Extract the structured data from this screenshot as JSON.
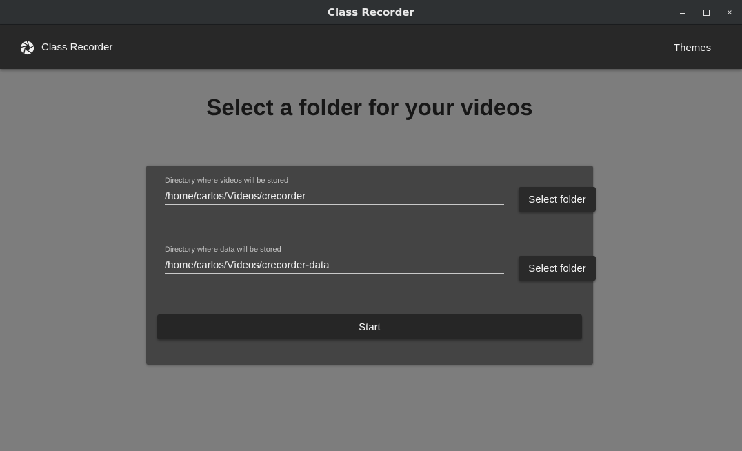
{
  "window": {
    "title": "Class Recorder",
    "minimize_icon": "minimize-icon",
    "maximize_icon": "maximize-icon",
    "close_icon": "close-icon",
    "close_glyph": "×"
  },
  "appbar": {
    "logo_icon": "camera-aperture-icon",
    "app_name": "Class Recorder",
    "themes_label": "Themes"
  },
  "main": {
    "heading": "Select a folder for your videos",
    "videos_field": {
      "label": "Directory where videos will be stored",
      "value": "/home/carlos/Vídeos/crecorder",
      "button_label": "Select folder"
    },
    "data_field": {
      "label": "Directory where data will be stored",
      "value": "/home/carlos/Vídeos/crecorder-data",
      "button_label": "Select folder"
    },
    "start_label": "Start"
  },
  "colors": {
    "background": "#7d7d7d",
    "appbar": "#282828",
    "card": "#444444",
    "button": "#2a2a2a"
  }
}
